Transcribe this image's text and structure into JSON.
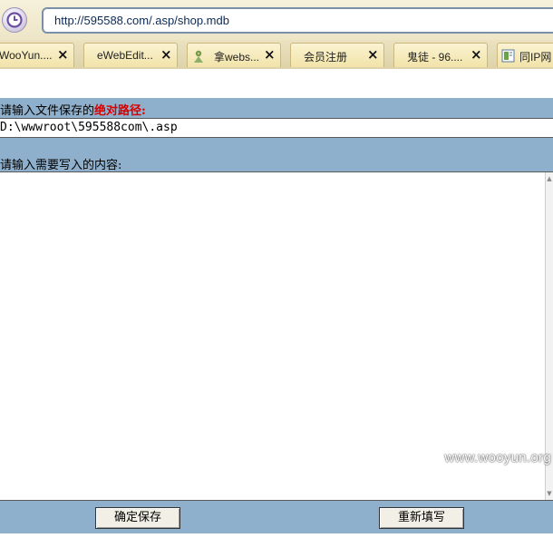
{
  "browser": {
    "address_url": "http://595588.com/.asp/shop.mdb",
    "tabs": [
      {
        "label": "WooYun....",
        "close": "×"
      },
      {
        "label": "eWebEdit...",
        "close": "×"
      },
      {
        "label": "拿webs...",
        "close": "×"
      },
      {
        "label": "会员注册",
        "close": "×"
      },
      {
        "label": "鬼徒 - 96....",
        "close": "×"
      },
      {
        "label": "同IP网"
      }
    ]
  },
  "form": {
    "path_label_prefix": "请输入文件保存的",
    "path_label_emphasis": "绝对路径:",
    "path_value": "D:\\wwwroot\\595588com\\.asp",
    "content_label": "请输入需要写入的内容:",
    "content_value": "",
    "save_button": "确定保存",
    "reset_button": "重新填写"
  },
  "watermark": "www.wooyun.org",
  "colors": {
    "label_bar": "#8fb0cc",
    "emphasis": "#d40000",
    "tab_bg": "#f1e3a8"
  }
}
